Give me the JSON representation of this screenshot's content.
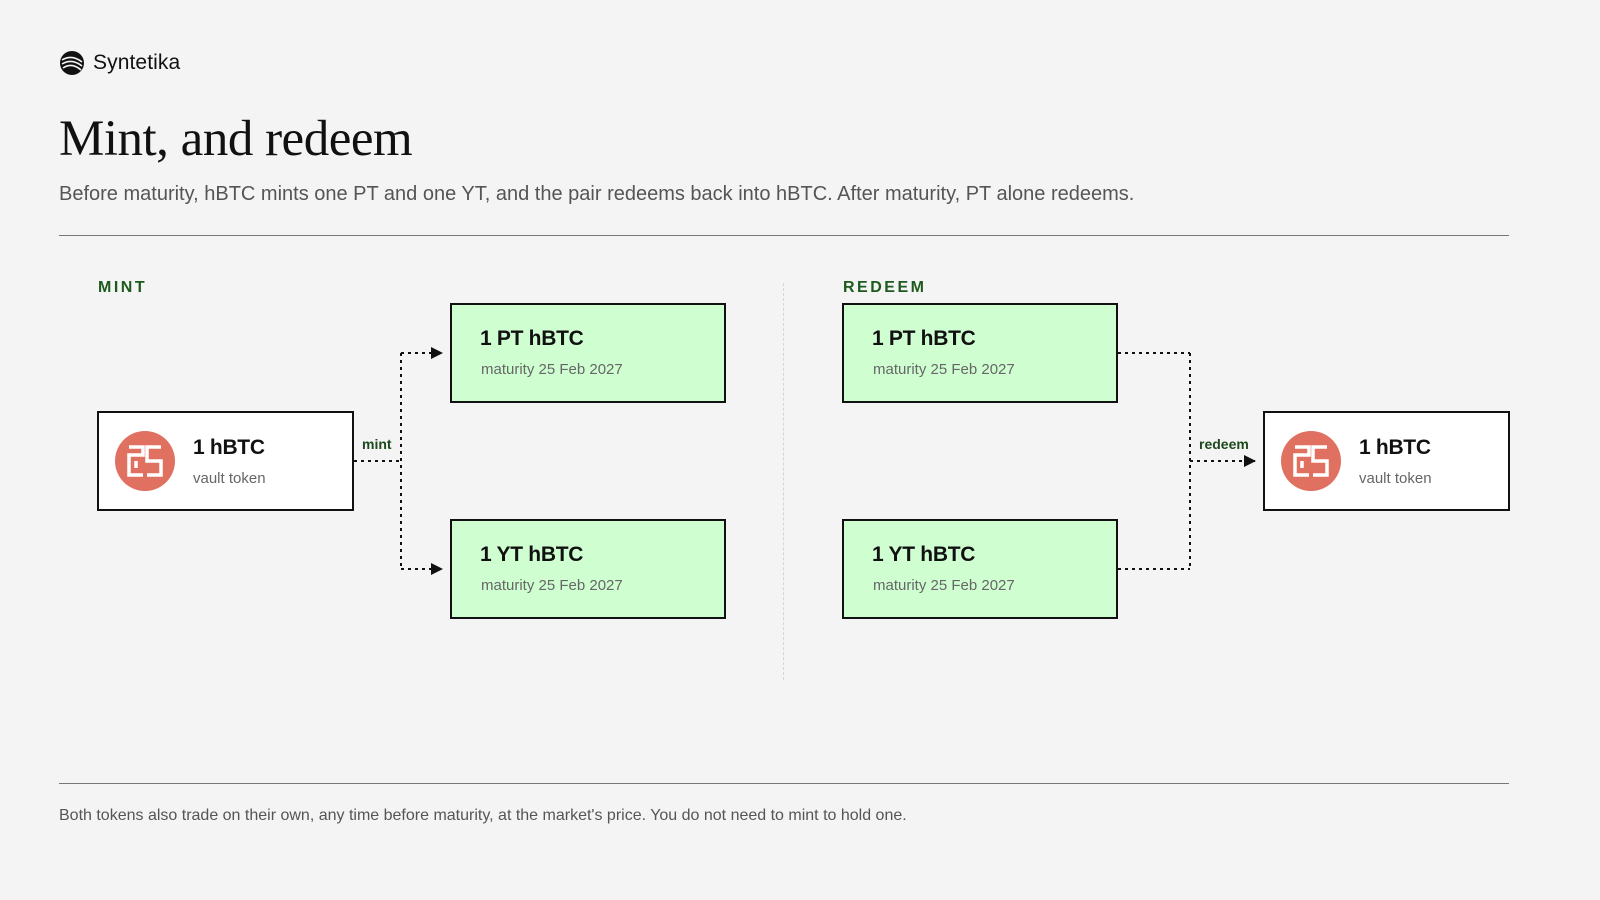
{
  "brand": {
    "name": "Syntetika",
    "logo_icon": "syntetika-logo-icon"
  },
  "header": {
    "title": "Mint, and redeem",
    "subtitle": "Before maturity, hBTC mints one PT and one YT, and the pair redeems back into hBTC. After maturity, PT alone redeems."
  },
  "mint": {
    "label": "MINT",
    "input": {
      "title": "1 hBTC",
      "subtitle": "vault token",
      "icon": "vault-token-icon"
    },
    "edge_label": "mint",
    "outputs": [
      {
        "title": "1 PT hBTC",
        "subtitle": "maturity 25 Feb 2027"
      },
      {
        "title": "1 YT hBTC",
        "subtitle": "maturity 25 Feb 2027"
      }
    ]
  },
  "redeem": {
    "label": "REDEEM",
    "inputs": [
      {
        "title": "1 PT hBTC",
        "subtitle": "maturity 25 Feb 2027"
      },
      {
        "title": "1 YT hBTC",
        "subtitle": "maturity 25 Feb 2027"
      }
    ],
    "edge_label": "redeem",
    "output": {
      "title": "1 hBTC",
      "subtitle": "vault token",
      "icon": "vault-token-icon"
    }
  },
  "footer": {
    "note": "Both tokens also trade on their own, any time before maturity, at the market's price. You do not need to mint to hold one."
  },
  "colors": {
    "background": "#f4f4f4",
    "token_box": "#cfffd1",
    "section_label": "#1d5a1d",
    "vault_icon": "#e0705f"
  }
}
